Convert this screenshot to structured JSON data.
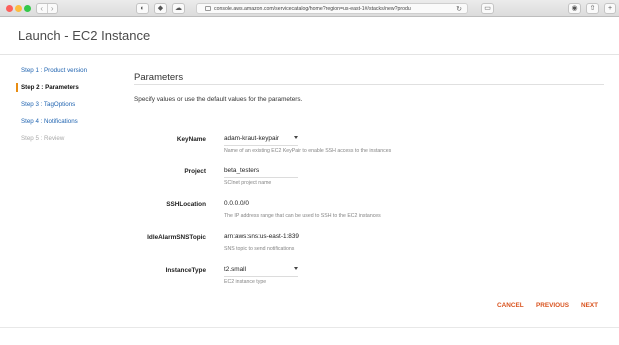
{
  "browser": {
    "url": "console.aws.amazon.com/servicecatalog/home?region=us-east-1#/stacks/new?produ",
    "reload_glyph": "↻"
  },
  "page": {
    "title": "Launch - EC2 Instance"
  },
  "steps": [
    {
      "label": "Step 1 : Product version",
      "state": "link"
    },
    {
      "label": "Step 2 : Parameters",
      "state": "active"
    },
    {
      "label": "Step 3 : TagOptions",
      "state": "link"
    },
    {
      "label": "Step 4 : Notifications",
      "state": "link"
    },
    {
      "label": "Step 5 : Review",
      "state": "disabled"
    }
  ],
  "section": {
    "title": "Parameters",
    "instructions": "Specify values or use the default values for the parameters."
  },
  "params": [
    {
      "label": "KeyName",
      "value": "adam-kraut-keypair",
      "help": "Name of an existing EC2 KeyPair to enable SSH access to the instances",
      "type": "select"
    },
    {
      "label": "Project",
      "value": "beta_testers",
      "help": "SCInet project name",
      "type": "text"
    },
    {
      "label": "SSHLocation",
      "value": "0.0.0.0/0",
      "help": "The IP address range that can be used to SSH to the EC2 instances",
      "type": "plain"
    },
    {
      "label": "IdleAlarmSNSTopic",
      "value": "arn:aws:sns:us-east-1:839",
      "help": "SNS topic to send notifications",
      "type": "plain"
    },
    {
      "label": "InstanceType",
      "value": "t2.small",
      "help": "EC2 instance type",
      "type": "select"
    }
  ],
  "actions": {
    "cancel": "CANCEL",
    "previous": "PREVIOUS",
    "next": "NEXT"
  },
  "colors": {
    "accent": "#d9531e",
    "link": "#1f63b0",
    "active_marker": "#e88d13"
  }
}
